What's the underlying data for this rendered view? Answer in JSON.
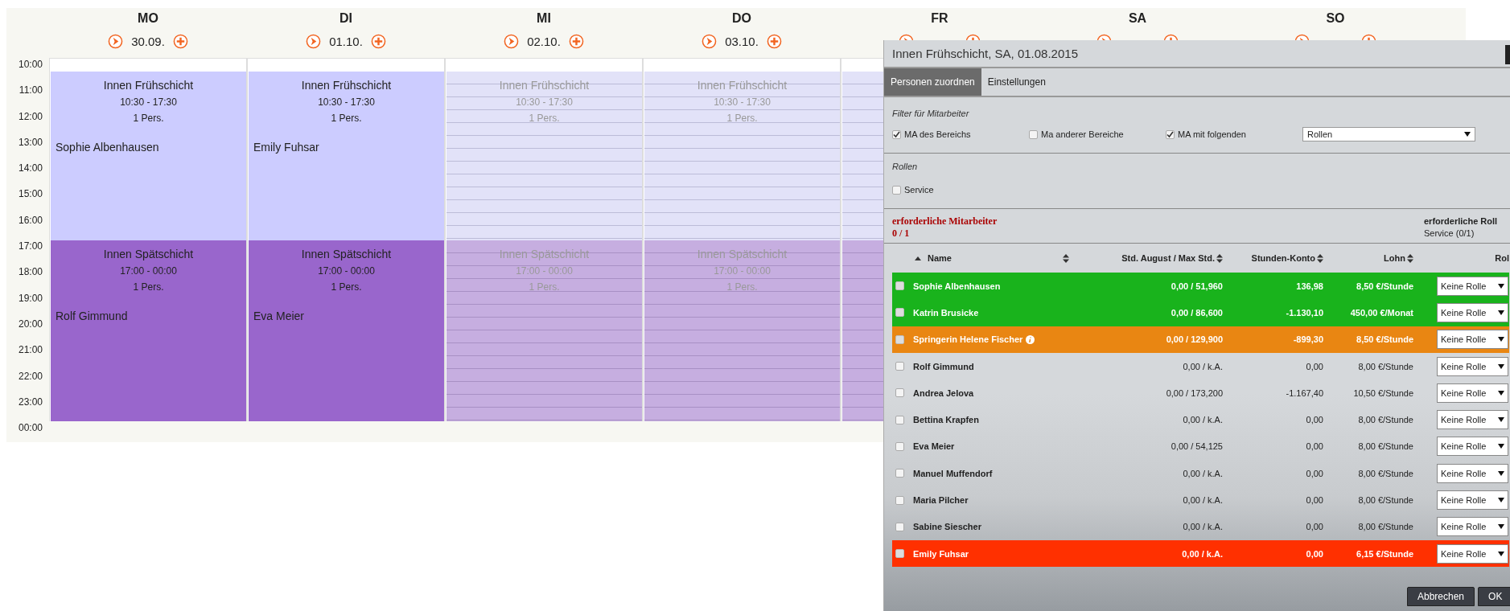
{
  "calendar": {
    "times": [
      "10:00",
      "11:00",
      "12:00",
      "13:00",
      "14:00",
      "15:00",
      "16:00",
      "17:00",
      "18:00",
      "19:00",
      "20:00",
      "21:00",
      "22:00",
      "23:00",
      "00:00"
    ],
    "days": [
      {
        "name": "MO",
        "date": "30.09.",
        "shifts": [
          {
            "kind": "early",
            "dimmed": false,
            "title": "Innen Frühschicht",
            "time": "10:30 - 17:30",
            "count": "1 Pers.",
            "person": "Sophie Albenhausen"
          },
          {
            "kind": "late",
            "dimmed": false,
            "title": "Innen Spätschicht",
            "time": "17:00 - 00:00",
            "count": "1 Pers.",
            "person": "Rolf Gimmund"
          }
        ]
      },
      {
        "name": "DI",
        "date": "01.10.",
        "shifts": [
          {
            "kind": "early",
            "dimmed": false,
            "title": "Innen Frühschicht",
            "time": "10:30 - 17:30",
            "count": "1 Pers.",
            "person": "Emily Fuhsar"
          },
          {
            "kind": "late",
            "dimmed": false,
            "title": "Innen Spätschicht",
            "time": "17:00 - 00:00",
            "count": "1 Pers.",
            "person": "Eva Meier"
          }
        ]
      },
      {
        "name": "MI",
        "date": "02.10.",
        "shifts": [
          {
            "kind": "early",
            "dimmed": true,
            "title": "Innen Frühschicht",
            "time": "10:30 - 17:30",
            "count": "1 Pers."
          },
          {
            "kind": "late",
            "dimmed": true,
            "title": "Innen Spätschicht",
            "time": "17:00 - 00:00",
            "count": "1 Pers."
          }
        ]
      },
      {
        "name": "DO",
        "date": "03.10.",
        "shifts": [
          {
            "kind": "early",
            "dimmed": true,
            "title": "Innen Frühschicht",
            "time": "10:30 - 17:30",
            "count": "1 Pers."
          },
          {
            "kind": "late",
            "dimmed": true,
            "title": "Innen Spätschicht",
            "time": "17:00 - 00:00",
            "count": "1 Pers."
          }
        ]
      },
      {
        "name": "FR",
        "shifts": [
          {
            "kind": "early",
            "dimmed": true
          },
          {
            "kind": "late",
            "dimmed": true
          }
        ]
      },
      {
        "name": "SA"
      },
      {
        "name": "SO"
      }
    ]
  },
  "dialog": {
    "title": "Innen Frühschicht, SA, 01.08.2015",
    "tabs": [
      {
        "label": "Personen zuordnen",
        "selected": true
      },
      {
        "label": "Einstellungen",
        "selected": false
      }
    ],
    "filter_heading": "Filter für Mitarbeiter",
    "filters": [
      {
        "label": "MA des Bereichs",
        "checked": true
      },
      {
        "label": "Ma anderer Bereiche",
        "checked": false
      },
      {
        "label": "MA mit folgenden",
        "checked": true
      }
    ],
    "filter_select": "Rollen",
    "roles_heading": "Rollen",
    "roles": [
      {
        "label": "Service",
        "checked": false
      }
    ],
    "required_staff": {
      "label": "erforderliche Mitarbeiter",
      "value": "0 / 1"
    },
    "required_roles": {
      "label": "erforderliche Roll",
      "value": "Service (0/1)"
    },
    "table": {
      "columns": [
        {
          "label": "Name",
          "sorted": true,
          "sortable": true
        },
        {
          "label": "Std. August / Max Std.",
          "sorted": false,
          "sortable": true
        },
        {
          "label": "Stunden-Konto",
          "sorted": false,
          "sortable": true
        },
        {
          "label": "Lohn",
          "sorted": false,
          "sortable": true
        },
        {
          "label": "Rol",
          "sorted": false,
          "sortable": false
        }
      ],
      "rows": [
        {
          "color": "#19b31c",
          "checked": false,
          "name": "Sophie Albenhausen",
          "info": false,
          "hours": "0,00 / 51,960",
          "balance": "136,98",
          "wage": "8,50 €/Stunde",
          "role": "Keine Rolle"
        },
        {
          "color": "#19b31c",
          "checked": false,
          "name": "Katrin Brusicke",
          "info": false,
          "hours": "0,00 / 86,600",
          "balance": "-1.130,10",
          "wage": "450,00 €/Monat",
          "role": "Keine Rolle"
        },
        {
          "color": "#e98612",
          "checked": false,
          "name": "Springerin Helene Fischer",
          "info": true,
          "hours": "0,00 / 129,900",
          "balance": "-899,30",
          "wage": "8,50 €/Stunde",
          "role": "Keine Rolle"
        },
        {
          "checked": false,
          "name": "Rolf Gimmund",
          "info": false,
          "hours": "0,00 / k.A.",
          "balance": "0,00",
          "wage": "8,00 €/Stunde",
          "role": "Keine Rolle"
        },
        {
          "checked": false,
          "name": "Andrea Jelova",
          "info": false,
          "hours": "0,00 / 173,200",
          "balance": "-1.167,40",
          "wage": "10,50 €/Stunde",
          "role": "Keine Rolle"
        },
        {
          "checked": false,
          "name": "Bettina Krapfen",
          "info": false,
          "hours": "0,00 / k.A.",
          "balance": "0,00",
          "wage": "8,00 €/Stunde",
          "role": "Keine Rolle"
        },
        {
          "checked": false,
          "name": "Eva Meier",
          "info": false,
          "hours": "0,00 / 54,125",
          "balance": "0,00",
          "wage": "8,00 €/Stunde",
          "role": "Keine Rolle"
        },
        {
          "checked": false,
          "name": "Manuel Muffendorf",
          "info": false,
          "hours": "0,00 / k.A.",
          "balance": "0,00",
          "wage": "8,00 €/Stunde",
          "role": "Keine Rolle"
        },
        {
          "checked": false,
          "name": "Maria Pilcher",
          "info": false,
          "hours": "0,00 / k.A.",
          "balance": "0,00",
          "wage": "8,00 €/Stunde",
          "role": "Keine Rolle"
        },
        {
          "checked": false,
          "name": "Sabine Siescher",
          "info": false,
          "hours": "0,00 / k.A.",
          "balance": "0,00",
          "wage": "8,00 €/Stunde",
          "role": "Keine Rolle"
        },
        {
          "color": "#ff3000",
          "checked": false,
          "name": "Emily Fuhsar",
          "info": false,
          "hours": "0,00 / k.A.",
          "balance": "0,00",
          "wage": "6,15 €/Stunde",
          "role": "Keine Rolle"
        }
      ]
    },
    "buttons": [
      "Abbrechen",
      "OK"
    ]
  }
}
